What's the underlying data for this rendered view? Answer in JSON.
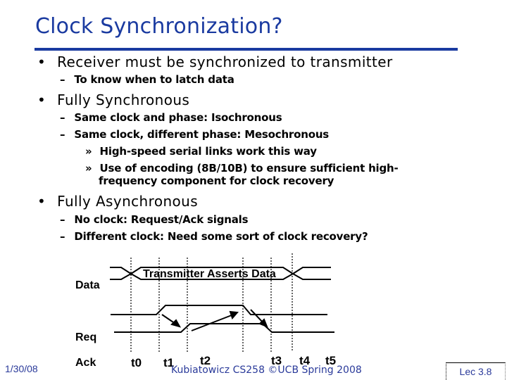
{
  "slide": {
    "title": "Clock Synchronization?",
    "colors": {
      "title": "#1a3aa0",
      "footer": "#2a3a9a",
      "text": "#000000"
    },
    "bullets": [
      {
        "level": 1,
        "marker": "•",
        "text": "Receiver must be synchronized to transmitter"
      },
      {
        "level": 2,
        "marker": "–",
        "text": "To know when to latch data"
      },
      {
        "level": 1,
        "marker": "•",
        "text": "Fully Synchronous"
      },
      {
        "level": 2,
        "marker": "–",
        "text": "Same clock and phase: Isochronous"
      },
      {
        "level": 2,
        "marker": "–",
        "text": "Same clock, different phase: Mesochronous"
      },
      {
        "level": 3,
        "marker": "»",
        "text": "High-speed serial links work this way"
      },
      {
        "level": 3,
        "marker": "»",
        "text": "Use of encoding (8B/10B) to ensure sufficient high-",
        "continuation": "frequency component for clock recovery"
      },
      {
        "level": 1,
        "marker": "•",
        "text": "Fully Asynchronous"
      },
      {
        "level": 2,
        "marker": "–",
        "text": "No clock: Request/Ack signals"
      },
      {
        "level": 2,
        "marker": "–",
        "text": "Different clock: Need some sort of clock recovery?"
      }
    ]
  },
  "timing_diagram": {
    "caption": "Transmitter Asserts Data",
    "signals": [
      "Data",
      "Req",
      "Ack"
    ],
    "time_marks": [
      "t0",
      "t1",
      "t2",
      "t3",
      "t4",
      "t5"
    ]
  },
  "footer": {
    "date": "1/30/08",
    "center": "Kubiatowicz CS258 ©UCB Spring 2008",
    "lecture": "Lec 3.8"
  }
}
